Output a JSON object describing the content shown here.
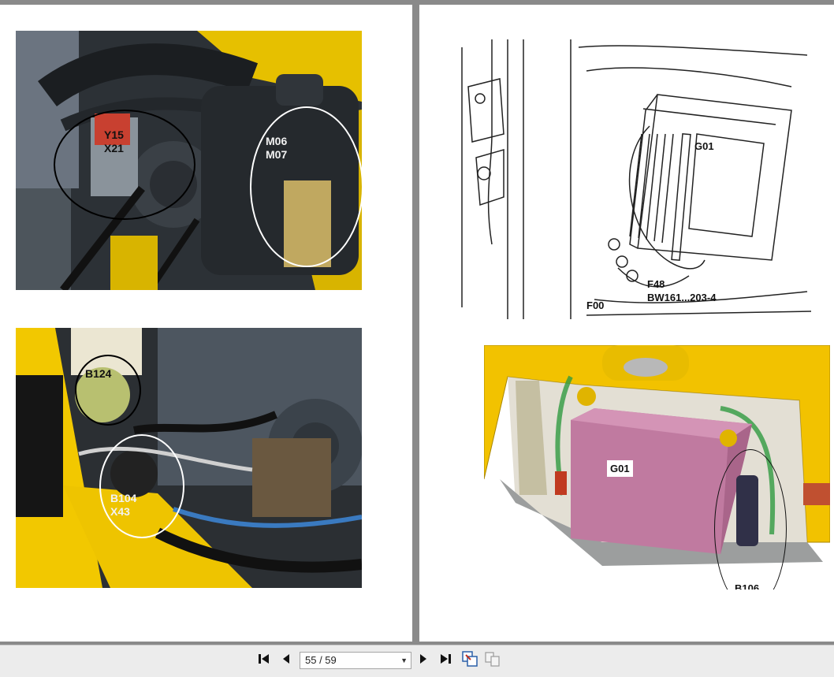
{
  "viewer": {
    "page_indicator": "55 / 59",
    "icons": [
      "first-page-icon",
      "previous-page-icon",
      "next-page-icon",
      "last-page-icon",
      "fit-page-icon",
      "two-page-icon"
    ]
  },
  "left_page": {
    "photo_top": {
      "callouts": [
        {
          "text": "Y15\nX21"
        },
        {
          "text": "M06\nM07"
        }
      ]
    },
    "photo_bottom": {
      "callouts": [
        {
          "text": "B124"
        },
        {
          "text": "B104\nX43"
        }
      ]
    }
  },
  "right_page": {
    "line_drawing": {
      "labels": [
        {
          "text": "G01"
        },
        {
          "text": "F48\nBW161...203-4"
        },
        {
          "text": "F00"
        }
      ]
    },
    "render_3d": {
      "labels": [
        {
          "text": "G01"
        },
        {
          "text": "B106"
        }
      ]
    }
  },
  "colors": {
    "machine_yellow": "#f2c200",
    "engine_grey": "#4a5058",
    "battery_pink": "#c07aa0",
    "background": "#8a8a8a"
  }
}
